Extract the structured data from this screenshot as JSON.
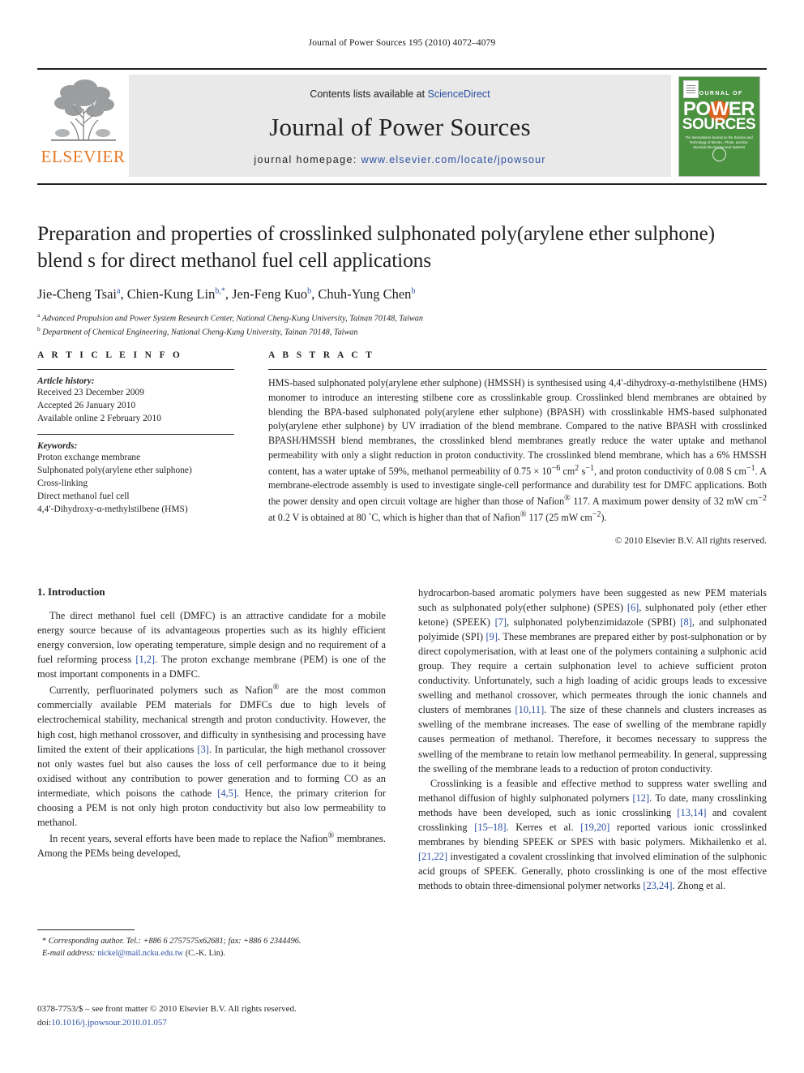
{
  "running_head": "Journal of Power Sources 195 (2010) 4072–4079",
  "masthead": {
    "contents_prefix": "Contents lists available at ",
    "sciencedirect": "ScienceDirect",
    "journal_title": "Journal of Power Sources",
    "homepage_prefix": "journal homepage: ",
    "homepage_url": "www.elsevier.com/locate/jpowsour",
    "publisher_word": "ELSEVIER",
    "cover": {
      "journal_of": "JOURNAL OF",
      "power": "POWER",
      "sources": "SOURCES",
      "subtitle": "The International Journal on the Science and Technology of Electro-, Photo- and Bio-chemical Electrochemical Systems"
    },
    "accent_orange": "#e87722",
    "link_blue": "#2b4ea2",
    "cover_green": "#4a9140"
  },
  "article": {
    "title": "Preparation and properties of crosslinked sulphonated poly(arylene ether sulphone) blend s for direct methanol fuel cell applications",
    "authors_html": "Jie-Cheng Tsai<sup>a</sup>, Chien-Kung Lin<sup>b,*</sup>, Jen-Feng Kuo<sup>b</sup>, Chuh-Yung Chen<sup>b</sup>",
    "affiliation_a": "Advanced Propulsion and Power System Research Center, National Cheng-Kung University, Tainan 70148, Taiwan",
    "affiliation_b": "Department of Chemical Engineering, National Cheng-Kung University, Tainan 70148, Taiwan"
  },
  "article_info": {
    "heading": "A R T I C L E    I N F O",
    "history_label": "Article history:",
    "received": "Received 23 December 2009",
    "accepted": "Accepted 26 January 2010",
    "available": "Available online 2 February 2010",
    "keywords_label": "Keywords:",
    "keywords": [
      "Proton exchange membrane",
      "Sulphonated poly(arylene ether sulphone)",
      "Cross-linking",
      "Direct methanol fuel cell",
      "4,4′-Dihydroxy-α-methylstilbene (HMS)"
    ]
  },
  "abstract": {
    "heading": "A B S T R A C T",
    "body_html": "HMS-based sulphonated poly(arylene ether sulphone) (HMSSH) is synthesised using 4,4′-dihydroxy-α-methylstilbene (HMS) monomer to introduce an interesting stilbene core as crosslinkable group. Crosslinked blend membranes are obtained by blending the BPA-based sulphonated poly(arylene ether sulphone) (BPASH) with crosslinkable HMS-based sulphonated poly(arylene ether sulphone) by UV irradiation of the blend membrane. Compared to the native BPASH with crosslinked BPASH/HMSSH blend membranes, the crosslinked blend membranes greatly reduce the water uptake and methanol permeability with only a slight reduction in proton conductivity. The crosslinked blend membrane, which has a 6% HMSSH content, has a water uptake of 59%, methanol permeability of 0.75 × 10<sup>−6</sup> cm<sup>2</sup> s<sup>−1</sup>, and proton conductivity of 0.08 S cm<sup>−1</sup>. A membrane-electrode assembly is used to investigate single-cell performance and durability test for DMFC applications. Both the power density and open circuit voltage are higher than those of Nafion<sup>®</sup> 117. A maximum power density of 32 mW cm<sup>−2</sup> at 0.2 V is obtained at 80 <sup>◦</sup>C, which is higher than that of Nafion<sup>®</sup> 117 (25 mW cm<sup>−2</sup>).",
    "copyright": "© 2010 Elsevier B.V. All rights reserved."
  },
  "introduction": {
    "heading": "1.  Introduction",
    "left_paragraphs_html": [
      "The direct methanol fuel cell (DMFC) is an attractive candidate for a mobile energy source because of its advantageous properties such as its highly efficient energy conversion, low operating temperature, simple design and no requirement of a fuel reforming process <span class=\"ref\">[1,2]</span>. The proton exchange membrane (PEM) is one of the most important components in a DMFC.",
      "Currently, perfluorinated polymers such as Nafion<sup>®</sup> are the most common commercially available PEM materials for DMFCs due to high levels of electrochemical stability, mechanical strength and proton conductivity. However, the high cost, high methanol crossover, and difficulty in synthesising and processing have limited the extent of their applications <span class=\"ref\">[3]</span>. In particular, the high methanol crossover not only wastes fuel but also causes the loss of cell performance due to it being oxidised without any contribution to power generation and to forming CO as an intermediate, which poisons the cathode <span class=\"ref\">[4,5]</span>. Hence, the primary criterion for choosing a PEM is not only high proton conductivity but also low permeability to methanol.",
      "In recent years, several efforts have been made to replace the Nafion<sup>®</sup> membranes. Among the PEMs being developed,"
    ],
    "right_paragraphs_html": [
      "hydrocarbon-based aromatic polymers have been suggested as new PEM materials such as sulphonated poly(ether sulphone) (SPES) <span class=\"ref\">[6]</span>, sulphonated poly (ether ether ketone) (SPEEK) <span class=\"ref\">[7]</span>, sulphonated polybenzimidazole (SPBI) <span class=\"ref\">[8]</span>, and sulphonated polyimide (SPI) <span class=\"ref\">[9]</span>. These membranes are prepared either by post-sulphonation or by direct copolymerisation, with at least one of the polymers containing a sulphonic acid group. They require a certain sulphonation level to achieve sufficient proton conductivity. Unfortunately, such a high loading of acidic groups leads to excessive swelling and methanol crossover, which permeates through the ionic channels and clusters of membranes <span class=\"ref\">[10,11]</span>. The size of these channels and clusters increases as swelling of the membrane increases. The ease of swelling of the membrane rapidly causes permeation of methanol. Therefore, it becomes necessary to suppress the swelling of the membrane to retain low methanol permeability. In general, suppressing the swelling of the membrane leads to a reduction of proton conductivity.",
      "Crosslinking is a feasible and effective method to suppress water swelling and methanol diffusion of highly sulphonated polymers <span class=\"ref\">[12]</span>. To date, many crosslinking methods have been developed, such as ionic crosslinking <span class=\"ref\">[13,14]</span> and covalent crosslinking <span class=\"ref\">[15–18]</span>. Kerres et al. <span class=\"ref\">[19,20]</span> reported various ionic crosslinked membranes by blending SPEEK or SPES with basic polymers. Mikhailenko et al. <span class=\"ref\">[21,22]</span> investigated a covalent crosslinking that involved elimination of the sulphonic acid groups of SPEEK. Generally, photo crosslinking is one of the most effective methods to obtain three-dimensional polymer networks <span class=\"ref\">[23,24]</span>. Zhong et al."
    ]
  },
  "footnotes": {
    "corresponding_html": "* <em>Corresponding author. Tel.: +886 6 2757575x62681; fax: +886 6 2344496.</em>",
    "corresponding_plain": "* Corresponding author. Tel.: +886 6 2757575x62681; fax: +886 6 2344496.",
    "email_label": "E-mail address:",
    "email": "nickel@mail.ncku.edu.tw",
    "email_suffix": " (C.-K. Lin).",
    "issn_line": "0378-7753/$ – see front matter © 2010 Elsevier B.V. All rights reserved.",
    "doi_label": "doi:",
    "doi": "10.1016/j.jpowsour.2010.01.057"
  }
}
